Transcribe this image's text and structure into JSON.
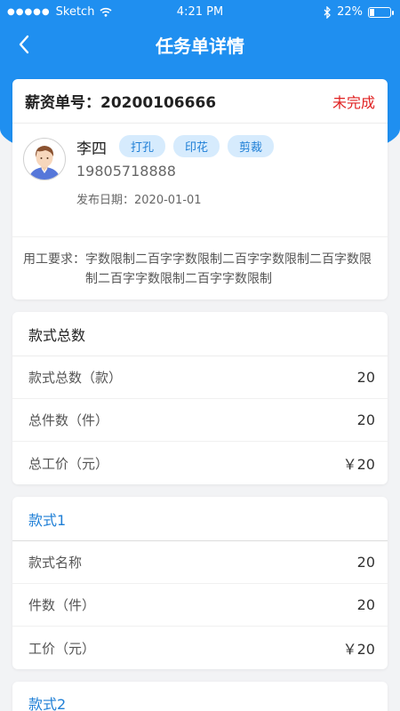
{
  "status_bar": {
    "carrier": "Sketch",
    "signal_dots": "●●●●●",
    "time": "4:21 PM",
    "battery_percent": "22%",
    "battery_level": 0.22
  },
  "nav": {
    "title": "任务单详情"
  },
  "order": {
    "label": "薪资单号：20200106666",
    "status": "未完成",
    "name": "李四",
    "tags": [
      "打孔",
      "印花",
      "剪裁"
    ],
    "phone": "19805718888",
    "publish_date": "发布日期：2020-01-01",
    "requirement_label": "用工要求：",
    "requirement_text": "字数限制二百字字数限制二百字字数限制二百字数限制二百字字数限制二百字字数限制"
  },
  "summary": {
    "title": "款式总数",
    "rows": [
      {
        "label": "款式总数（款）",
        "value": "20"
      },
      {
        "label": "总件数（件）",
        "value": "20"
      },
      {
        "label": "总工价（元）",
        "value": "￥20"
      }
    ]
  },
  "styles": [
    {
      "title": "款式1",
      "rows": [
        {
          "label": "款式名称",
          "value": "20"
        },
        {
          "label": "件数（件）",
          "value": "20"
        },
        {
          "label": "工价（元）",
          "value": "￥20"
        }
      ]
    },
    {
      "title": "款式2"
    }
  ],
  "colors": {
    "primary": "#1f8ff0",
    "status_red": "#e02020",
    "tag_bg": "#d6ebfd",
    "tag_text": "#1f7fd6"
  }
}
